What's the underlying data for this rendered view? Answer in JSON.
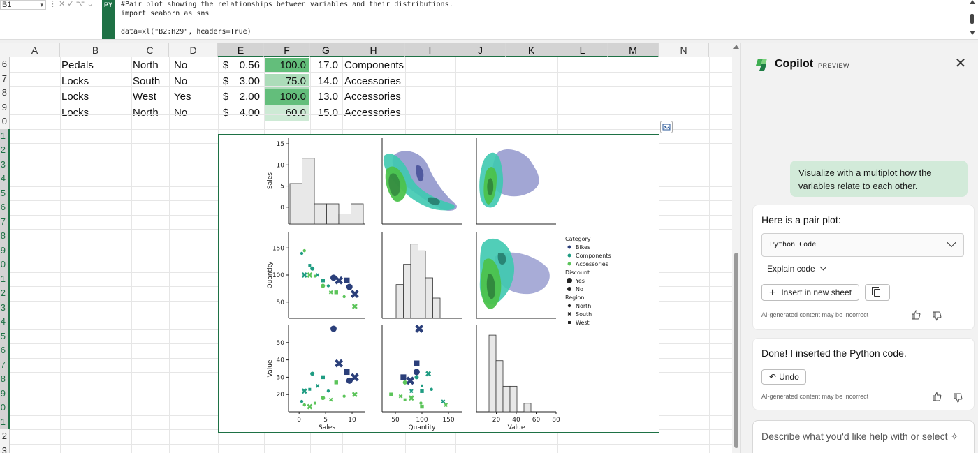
{
  "formula_bar": {
    "name_box": "B1",
    "py_badge": "PY",
    "code_lines": [
      "#Pair plot showing the relationships between variables and their distributions.",
      "import seaborn as sns",
      "",
      "data=xl(\"B2:H29\", headers=True)"
    ]
  },
  "sheet": {
    "columns": [
      "A",
      "B",
      "C",
      "D",
      "E",
      "F",
      "G",
      "H",
      "I",
      "J",
      "K",
      "L",
      "M",
      "N"
    ],
    "row_numbers": [
      "6",
      "7",
      "8",
      "9",
      "0",
      "1",
      "2",
      "3",
      "4",
      "5",
      "6",
      "7",
      "8",
      "9",
      "0",
      "1",
      "2",
      "3",
      "4",
      "5",
      "6",
      "7",
      "8",
      "9",
      "0",
      "1",
      "2",
      "3"
    ],
    "rows": [
      {
        "product": "Pedals",
        "region": "North",
        "discount": "No",
        "currency": "$",
        "price": "0.56",
        "quantity": "100.0",
        "sales": "17.0",
        "category": "Components",
        "qty_level": 1.0
      },
      {
        "product": "Locks",
        "region": "South",
        "discount": "No",
        "currency": "$",
        "price": "3.00",
        "quantity": "75.0",
        "sales": "14.0",
        "category": "Accessories",
        "qty_level": 0.45
      },
      {
        "product": "Locks",
        "region": "West",
        "discount": "Yes",
        "currency": "$",
        "price": "2.00",
        "quantity": "100.0",
        "sales": "13.0",
        "category": "Accessories",
        "qty_level": 1.0
      },
      {
        "product": "Locks",
        "region": "North",
        "discount": "No",
        "currency": "$",
        "price": "4.00",
        "quantity": "60.0",
        "sales": "15.0",
        "category": "Accessories",
        "qty_level": 0.2
      }
    ]
  },
  "pairplot": {
    "variables": [
      "Sales",
      "Quantity",
      "Value"
    ],
    "sales_ticks": [
      "0",
      "5",
      "10"
    ],
    "sales_y_ticks": [
      "15",
      "10",
      "5",
      "0"
    ],
    "quantity_ticks": [
      "50",
      "100",
      "150"
    ],
    "quantity_y_ticks": [
      "150",
      "100",
      "50"
    ],
    "value_ticks": [
      "20",
      "40",
      "60",
      "80"
    ],
    "value_y_ticks": [
      "50",
      "40",
      "30",
      "20"
    ],
    "legend": {
      "category_title": "Category",
      "categories": [
        "Bikes",
        "Components",
        "Accessories"
      ],
      "discount_title": "Discount",
      "discounts": [
        "Yes",
        "No"
      ],
      "region_title": "Region",
      "regions": [
        "North",
        "South",
        "West"
      ]
    },
    "colors": {
      "bikes": "#2b3f7a",
      "components": "#1f9c82",
      "accessories": "#5cc45a",
      "kde_bikes": "#8b90c9",
      "kde_components": "#3ec9b0",
      "kde_accessories": "#4cc24c"
    }
  },
  "chart_data": {
    "type": "scatter",
    "title": "",
    "series": [
      {
        "name": "Bikes",
        "x_sales": [
          6.5,
          7.5,
          9,
          9.5,
          10.5
        ],
        "y_quantity": [
          95,
          90,
          90,
          78,
          65
        ],
        "y_value": [
          58,
          38,
          33,
          28,
          30
        ]
      },
      {
        "name": "Components",
        "x_sales": [
          0.5,
          1,
          2,
          2.5,
          3.5,
          4.5,
          5.5
        ],
        "y_quantity": [
          140,
          100,
          118,
          112,
          100,
          90,
          80
        ],
        "y_value": [
          16,
          22,
          23,
          32,
          25,
          30,
          22
        ]
      },
      {
        "name": "Accessories",
        "x_sales": [
          1,
          2,
          3,
          4.5,
          6,
          7,
          8.5,
          10.5
        ],
        "y_quantity": [
          145,
          100,
          98,
          80,
          68,
          68,
          60,
          42
        ],
        "y_value": [
          14,
          13,
          15,
          18,
          17,
          27,
          19,
          20
        ]
      }
    ],
    "sales_histogram": [
      4,
      6.5,
      2,
      2,
      1,
      2
    ],
    "quantity_histogram": [
      2.5,
      4,
      5.5,
      5,
      3,
      1.5
    ],
    "value_histogram": [
      9,
      6,
      3,
      3,
      0,
      1
    ]
  },
  "copilot": {
    "title": "Copilot",
    "badge": "PREVIEW",
    "user_message": "Visualize with a multiplot how the variables relate to each other.",
    "reply1": "Here is a pair plot:",
    "code_dropdown": "Python Code",
    "explain": "Explain code",
    "insert_button": "Insert  in new sheet",
    "disclaimer": "AI-generated content may be incorrect",
    "reply2": "Done! I inserted the Python code.",
    "undo_button": "Undo",
    "compose_placeholder": "Describe what you'd like help with or select"
  }
}
